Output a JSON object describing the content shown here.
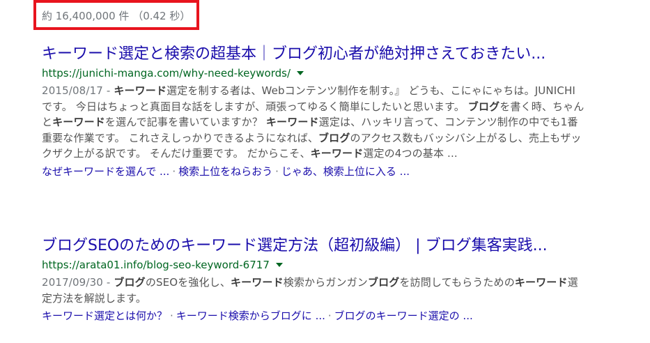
{
  "stats": {
    "text": "約 16,400,000 件 （0.42 秒）"
  },
  "results": [
    {
      "title": "キーワード選定と検索の超基本｜ブログ初心者が絶対押さえておきたい...",
      "url": "https://junichi-manga.com/why-need-keywords/",
      "date": "2015/08/17 - ",
      "snippet": [
        {
          "b": "キーワード"
        },
        {
          "t": "選定を制する者は、Webコンテンツ制作を制す。』 どうも、こにゃにゃちは。JUNICHIです。 今日はちょっと真面目な話をしますが、頑張ってゆるく簡単にしたいと思います。 "
        },
        {
          "b": "ブログ"
        },
        {
          "t": "を書く時、ちゃんと"
        },
        {
          "b": "キーワード"
        },
        {
          "t": "を選んで記事を書いていますか？ "
        },
        {
          "b": "キーワード"
        },
        {
          "t": "選定は、ハッキリ言って、コンテンツ制作の中でも1番重要な作業です。 これさえしっかりできるようになれば、"
        },
        {
          "b": "ブログ"
        },
        {
          "t": "のアクセス数もバッシバシ上がるし、売上もザックザク上がる訳です。 そんだけ重要です。 だからこそ、"
        },
        {
          "b": "キーワード"
        },
        {
          "t": "選定の4つの基本 ..."
        }
      ],
      "sitelinks": [
        "なぜキーワードを選んで ...",
        "検索上位をねらおう",
        "じゃあ、検索上位に入る ..."
      ]
    },
    {
      "title": "ブログSEOのためのキーワード選定方法（超初級編） | ブログ集客実践...",
      "url": "https://arata01.info/blog-seo-keyword-6717",
      "date": "2017/09/30 - ",
      "snippet": [
        {
          "b": "ブログ"
        },
        {
          "t": "のSEOを強化し、"
        },
        {
          "b": "キーワード"
        },
        {
          "t": "検索からガンガン"
        },
        {
          "b": "ブログ"
        },
        {
          "t": "を訪問してもらうための"
        },
        {
          "b": "キーワード"
        },
        {
          "t": "選定方法を解説します。"
        }
      ],
      "sitelinks": [
        "キーワード選定とは何か？",
        "キーワード検索からブログに ...",
        "ブログのキーワード選定の ..."
      ]
    }
  ],
  "colors": {
    "title": "#1a0dab",
    "url": "#006621",
    "snippet": "#545454",
    "meta": "#70757a",
    "highlight_box": "#e8141e"
  },
  "icons": {
    "url_menu": "dropdown-caret-icon"
  }
}
